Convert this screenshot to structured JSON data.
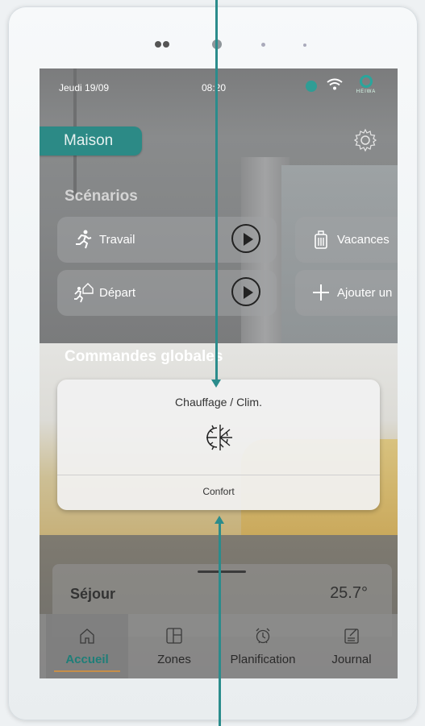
{
  "status": {
    "date": "Jeudi 19/09",
    "time": "08:20",
    "brand": "HEIWA"
  },
  "header": {
    "home_tab": "Maison"
  },
  "scenarios": {
    "title": "Scénarios",
    "items": [
      {
        "label": "Travail",
        "icon": "running-person-icon"
      },
      {
        "label": "Vacances",
        "icon": "suitcase-icon"
      },
      {
        "label": "Départ",
        "icon": "leave-home-icon"
      },
      {
        "label": "Ajouter un",
        "icon": "plus-icon"
      }
    ]
  },
  "commands": {
    "title": "Commandes globales",
    "card_title": "Chauffage / Clim.",
    "mode": "Confort",
    "icon": "heat-cool-icon"
  },
  "room": {
    "name": "Séjour",
    "temperature": "25.7°"
  },
  "nav": {
    "items": [
      {
        "label": "Accueil",
        "icon": "home-icon",
        "active": true
      },
      {
        "label": "Zones",
        "icon": "zones-icon"
      },
      {
        "label": "Planification",
        "icon": "alarm-clock-icon"
      },
      {
        "label": "Journal",
        "icon": "journal-icon"
      }
    ]
  },
  "colors": {
    "accent": "#2c8a86",
    "active_nav": "#1e7e78",
    "underline": "#c78f4a"
  }
}
